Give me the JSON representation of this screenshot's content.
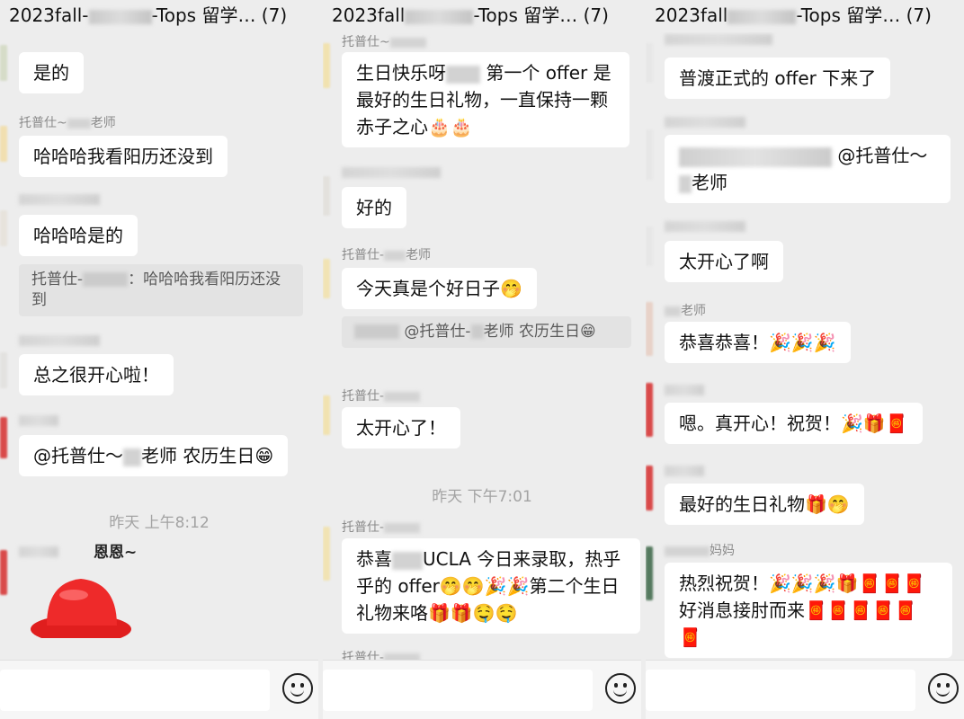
{
  "panels": [
    {
      "title": "2023fall-",
      "title_suffix": "-Tops 留学… (7)",
      "sender_name_1": "托普仕~",
      "sender_name_1_suffix": "老师",
      "messages": {
        "m1": "是的",
        "m2": "哈哈哈我看阳历还没到",
        "m3": "哈哈哈是的",
        "quote_prefix": "托普仕-",
        "quote_text": "：哈哈哈我看阳历还没到",
        "m4": "总之很开心啦！",
        "m5_prefix": "@托普仕～",
        "m5_suffix": "老师 农历生日",
        "m5_emoji": "😁"
      },
      "timestamp": "昨天 上午8:12",
      "sticker_text": "恩恩~"
    },
    {
      "title": "2023fall",
      "title_suffix": "-Tops 留学… (7)",
      "top_name": "托普仕~",
      "messages": {
        "m1_a": "生日快乐呀",
        "m1_b": "第一个 offer 是最好的生日礼物，一直保持一颗赤子之心",
        "m1_emoji": "🎂🎂",
        "m2": "好的",
        "name_3": "托普仕-",
        "name_3_suffix": "老师",
        "m3": "今天真是个好日子",
        "m3_emoji": "🤭",
        "quote_text": "@托普仕-",
        "quote_text_2": "老师 农历生日",
        "quote_emoji": "😁",
        "name_4": "托普仕-",
        "m4": "太开心了！",
        "name_5": "托普仕-",
        "m5_a": "恭喜",
        "m5_b": "UCLA 今日来录取，热乎乎的 offer",
        "m5_emoji_1": "🤭🤭🎉🎉",
        "m5_c": "第二个生日礼物来咯",
        "m5_emoji_2": "🎁🎁🤤🤤",
        "name_6": "托普仕-"
      },
      "timestamp": "昨天 下午7:01"
    },
    {
      "title": "2023fall",
      "title_suffix": "-Tops 留学… (7)",
      "messages": {
        "m1": "普渡正式的 offer 下来了",
        "m2_a": "@托普仕～",
        "m2_b": "老师",
        "m3": "太开心了啊",
        "name_4": "老师",
        "m4": "恭喜恭喜！",
        "m4_emoji": "🎉🎉🎉",
        "m5": "嗯。真开心！祝贺！",
        "m5_emoji": "🎉🎁🧧",
        "m6": "最好的生日礼物",
        "m6_emoji": "🎁🤭",
        "name_7": "妈妈",
        "m7_a": "热烈祝贺！",
        "m7_emoji_1": "🎉🎉🎉🎁🧧🧧🧧",
        "m7_b": "好消息接肘而来",
        "m7_emoji_2": "🧧🧧🧧🧧🧧🧧"
      }
    }
  ],
  "icons": {
    "emoji_button": "smiley-face-icon"
  },
  "colors": {
    "background": "#ededed",
    "bubble": "#ffffff",
    "quote": "#e3e3e3",
    "meta_text": "#8a8a8a"
  }
}
